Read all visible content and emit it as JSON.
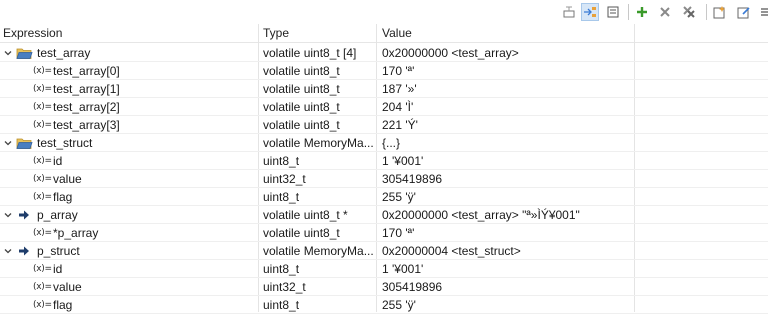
{
  "toolbar": {
    "buttons": [
      {
        "name": "show-type-names-icon",
        "active": false
      },
      {
        "name": "show-logical-structure-icon",
        "active": true
      },
      {
        "name": "collapse-all-icon",
        "active": false
      },
      {
        "name": "add-expression-icon",
        "active": false
      },
      {
        "name": "remove-expression-icon",
        "active": false
      },
      {
        "name": "remove-all-expressions-icon",
        "active": false
      },
      {
        "name": "new-view-icon",
        "active": false
      },
      {
        "name": "pin-icon",
        "active": false
      },
      {
        "name": "view-menu-icon",
        "active": false
      }
    ]
  },
  "columns": {
    "expression": "Expression",
    "type": "Type",
    "value": "Value"
  },
  "rows": [
    {
      "kind": "group",
      "level": 0,
      "expanded": true,
      "expression": "test_array",
      "type": "volatile uint8_t [4]",
      "value": "0x20000000 <test_array>"
    },
    {
      "kind": "var",
      "level": 1,
      "expression": "test_array[0]",
      "type": "volatile uint8_t",
      "value": "170 'ª'"
    },
    {
      "kind": "var",
      "level": 1,
      "expression": "test_array[1]",
      "type": "volatile uint8_t",
      "value": "187 '»'"
    },
    {
      "kind": "var",
      "level": 1,
      "expression": "test_array[2]",
      "type": "volatile uint8_t",
      "value": "204 'Ì'"
    },
    {
      "kind": "var",
      "level": 1,
      "expression": "test_array[3]",
      "type": "volatile uint8_t",
      "value": "221 'Ý'"
    },
    {
      "kind": "group",
      "level": 0,
      "expanded": true,
      "expression": "test_struct",
      "type": "volatile MemoryMa...",
      "value": "{...}"
    },
    {
      "kind": "var",
      "level": 1,
      "expression": "id",
      "type": "uint8_t",
      "value": "1 '¥001'"
    },
    {
      "kind": "var",
      "level": 1,
      "expression": "value",
      "type": "uint32_t",
      "value": "305419896"
    },
    {
      "kind": "var",
      "level": 1,
      "expression": "flag",
      "type": "uint8_t",
      "value": "255 'ÿ'"
    },
    {
      "kind": "pointer",
      "level": 0,
      "expanded": true,
      "expression": "p_array",
      "type": "volatile uint8_t *",
      "value": "0x20000000 <test_array> \"ª»ÌÝ¥001\""
    },
    {
      "kind": "var",
      "level": 1,
      "expression": "*p_array",
      "type": "volatile uint8_t",
      "value": "170 'ª'"
    },
    {
      "kind": "pointer",
      "level": 0,
      "expanded": true,
      "expression": "p_struct",
      "type": "volatile MemoryMa...",
      "value": "0x20000004 <test_struct>"
    },
    {
      "kind": "var",
      "level": 1,
      "expression": "id",
      "type": "uint8_t",
      "value": "1 '¥001'"
    },
    {
      "kind": "var",
      "level": 1,
      "expression": "value",
      "type": "uint32_t",
      "value": "305419896"
    },
    {
      "kind": "var",
      "level": 1,
      "expression": "flag",
      "type": "uint8_t",
      "value": "255 'ÿ'"
    }
  ],
  "icons": {
    "variable_glyph": "(x)="
  },
  "colors": {
    "pointer_arrow": "#1f3d6b",
    "folder_yellow": "#e8c25a",
    "folder_blue": "#4a7fc1",
    "add_green": "#3a9a2a"
  }
}
